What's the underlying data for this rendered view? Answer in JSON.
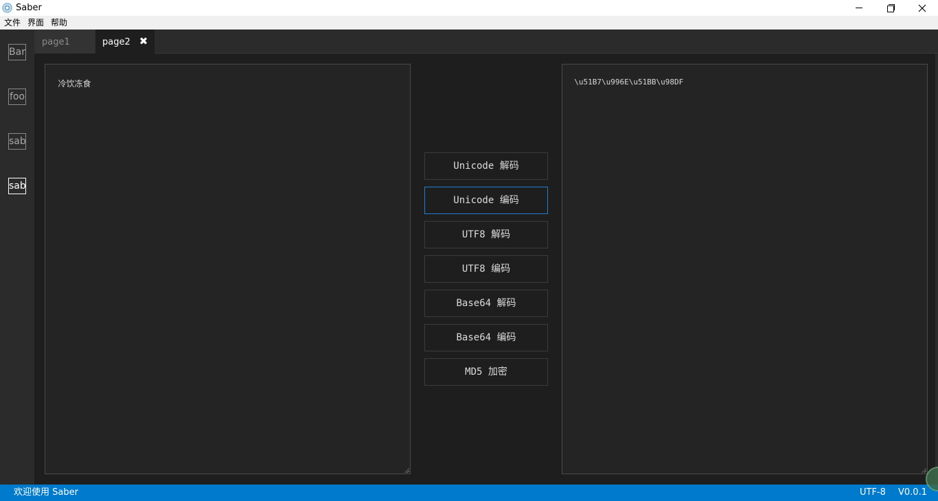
{
  "window": {
    "title": "Saber",
    "icon": "app-logo-icon",
    "controls": [
      "minimize-icon",
      "maximize-icon",
      "close-icon"
    ]
  },
  "menu": [
    {
      "label": "文件"
    },
    {
      "label": "界面"
    },
    {
      "label": "帮助"
    }
  ],
  "sidebar": {
    "items": [
      {
        "label": "Bar",
        "active": false
      },
      {
        "label": "foo",
        "active": false
      },
      {
        "label": "sab",
        "active": false
      },
      {
        "label": "sab",
        "active": true
      }
    ]
  },
  "tabs": [
    {
      "label": "page1",
      "active": false
    },
    {
      "label": "page2",
      "active": true,
      "close_glyph": "✖"
    }
  ],
  "editor": {
    "input_text": "冷饮冻食",
    "output_text": "\\u51B7\\u996E\\u51BB\\u98DF"
  },
  "actions": [
    {
      "label": "Unicode 解码",
      "focused": false
    },
    {
      "label": "Unicode 编码",
      "focused": true
    },
    {
      "label": "UTF8 解码",
      "focused": false
    },
    {
      "label": "UTF8 编码",
      "focused": false
    },
    {
      "label": "Base64 解码",
      "focused": false
    },
    {
      "label": "Base64 编码",
      "focused": false
    },
    {
      "label": "MD5 加密",
      "focused": false
    }
  ],
  "status": {
    "welcome": "欢迎使用 Saber",
    "encoding": "UTF-8",
    "version": "V0.0.1"
  },
  "colors": {
    "status_bar": "#007acc",
    "focus_accent": "#1f7fd0",
    "background": "#1e1e1e"
  }
}
